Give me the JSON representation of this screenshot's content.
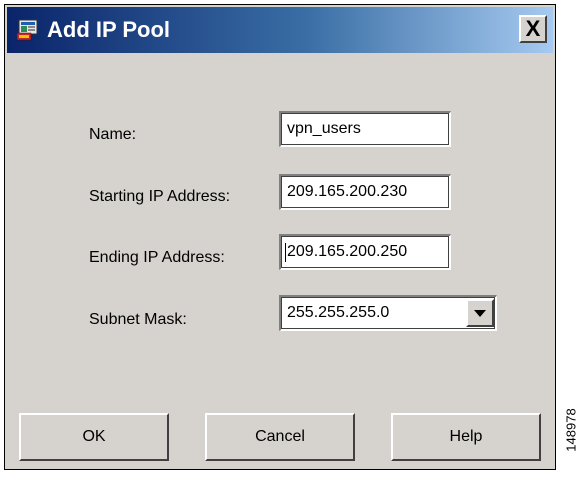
{
  "window": {
    "title": "Add IP Pool",
    "close_label": "X"
  },
  "form": {
    "name_label": "Name:",
    "name_value": "vpn_users",
    "start_label": "Starting IP Address:",
    "start_value": "209.165.200.230",
    "end_label": "Ending IP Address:",
    "end_value": "209.165.200.250",
    "mask_label": "Subnet Mask:",
    "mask_value": "255.255.255.0"
  },
  "buttons": {
    "ok": "OK",
    "cancel": "Cancel",
    "help": "Help"
  },
  "figure_id": "148978"
}
